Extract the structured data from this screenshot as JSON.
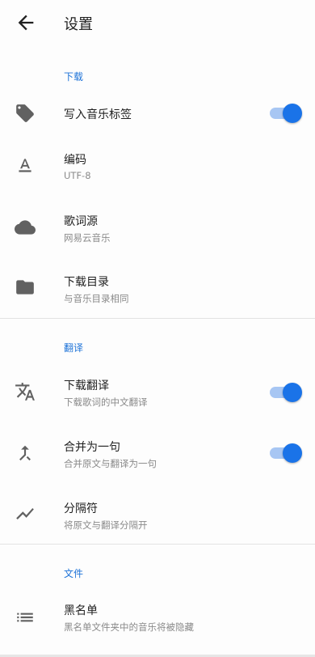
{
  "header": {
    "title": "设置"
  },
  "sections": {
    "download": {
      "title": "下载",
      "items": [
        {
          "label": "写入音乐标签",
          "switch_on": true
        },
        {
          "label": "编码",
          "sub": "UTF-8"
        },
        {
          "label": "歌词源",
          "sub": "网易云音乐"
        },
        {
          "label": "下载目录",
          "sub": "与音乐目录相同"
        }
      ]
    },
    "translate": {
      "title": "翻译",
      "items": [
        {
          "label": "下载翻译",
          "sub": "下载歌词的中文翻译",
          "switch_on": true
        },
        {
          "label": "合并为一句",
          "sub": "合并原文与翻译为一句",
          "switch_on": true
        },
        {
          "label": "分隔符",
          "sub": "将原文与翻译分隔开"
        }
      ]
    },
    "file": {
      "title": "文件",
      "items": [
        {
          "label": "黑名单",
          "sub": "黑名单文件夹中的音乐将被隐藏"
        }
      ]
    }
  },
  "colors": {
    "accent": "#1a73e8",
    "icon": "#616161"
  }
}
